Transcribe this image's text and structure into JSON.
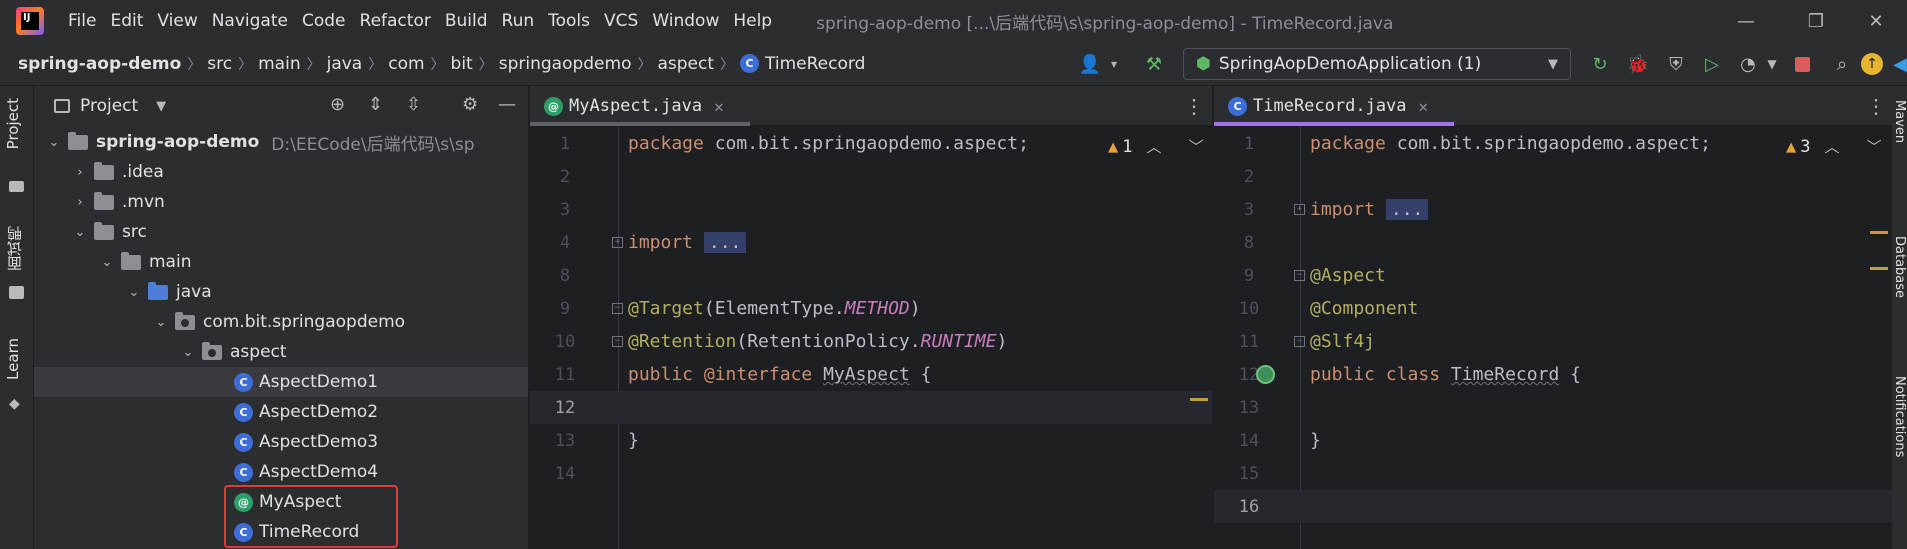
{
  "app": {
    "logo_text": "IJ"
  },
  "menu": [
    "File",
    "Edit",
    "View",
    "Navigate",
    "Code",
    "Refactor",
    "Build",
    "Run",
    "Tools",
    "VCS",
    "Window",
    "Help"
  ],
  "window_title": "spring-aop-demo [...\\后端代码\\s\\spring-aop-demo] - TimeRecord.java",
  "breadcrumb": [
    "spring-aop-demo",
    "src",
    "main",
    "java",
    "com",
    "bit",
    "springaopdemo",
    "aspect",
    "TimeRecord"
  ],
  "run_config": "SpringAopDemoApplication (1)",
  "left_tabs": {
    "project": "Project",
    "tab2": "面试鸭",
    "learn": "Learn"
  },
  "right_tabs": [
    "Maven",
    "Database",
    "Notifications"
  ],
  "project_panel": {
    "title": "Project",
    "root": {
      "name": "spring-aop-demo",
      "path": "D:\\EECode\\后端代码\\s\\sp"
    },
    "items": [
      {
        "name": ".idea"
      },
      {
        "name": ".mvn"
      },
      {
        "name": "src"
      },
      {
        "name": "main"
      },
      {
        "name": "java"
      },
      {
        "name": "com.bit.springaopdemo"
      },
      {
        "name": "aspect"
      },
      {
        "name": "AspectDemo1"
      },
      {
        "name": "AspectDemo2"
      },
      {
        "name": "AspectDemo3"
      },
      {
        "name": "AspectDemo4"
      },
      {
        "name": "MyAspect"
      },
      {
        "name": "TimeRecord"
      }
    ]
  },
  "editor_left": {
    "tab_label": "MyAspect.java",
    "warnings": "1",
    "lines": {
      "n1": "1",
      "n2": "2",
      "n3": "3",
      "n4": "4",
      "n8": "8",
      "n9": "9",
      "n10": "10",
      "n11": "11",
      "n12": "12",
      "n13": "13",
      "n14": "14",
      "pkg_kw": "package",
      "pkg_name": " com.bit.springaopdemo.aspect;",
      "import_kw": "import",
      "fold": "...",
      "target_ann": "@Target",
      "target_open": "(ElementType.",
      "target_val": "METHOD",
      "target_close": ")",
      "ret_ann": "@Retention",
      "ret_open": "(RetentionPolicy.",
      "ret_val": "RUNTIME",
      "ret_close": ")",
      "pub_kw": "public",
      "iface_kw": " @interface",
      "iface_name": "MyAspect",
      "iface_brace": " {",
      "close_brace": "}"
    }
  },
  "editor_right": {
    "tab_label": "TimeRecord.java",
    "warnings": "3",
    "lines": {
      "aspect_ann": "@Aspect",
      "component_ann": "@Component",
      "slf4j_ann": "@Slf4j",
      "pub_kw": "public",
      "class_kw": " class",
      "class_name": "TimeRecord",
      "class_brace": " {",
      "n15": "15",
      "n16": "16"
    }
  }
}
